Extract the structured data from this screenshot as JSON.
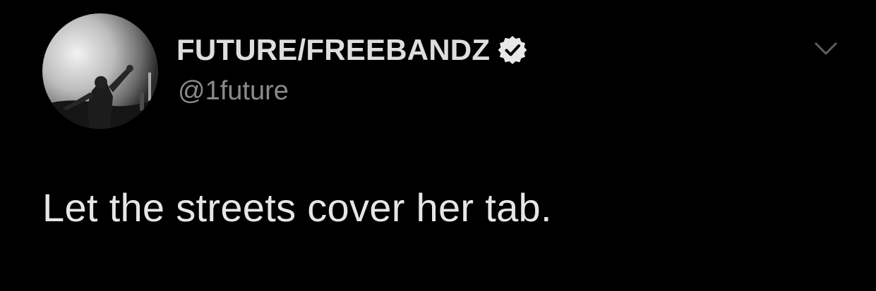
{
  "tweet": {
    "author": {
      "display_name": "FUTURE/FREEBANDZ",
      "handle": "@1future",
      "verified": true,
      "avatar_icon": "profile-photo-icon"
    },
    "text": "Let the streets cover her tab.",
    "menu_icon": "chevron-down-icon"
  },
  "colors": {
    "background": "#000000",
    "name": "#dedede",
    "handle": "#8a8a8a",
    "text": "#e6e6e6",
    "icon": "#5f5f5f"
  }
}
